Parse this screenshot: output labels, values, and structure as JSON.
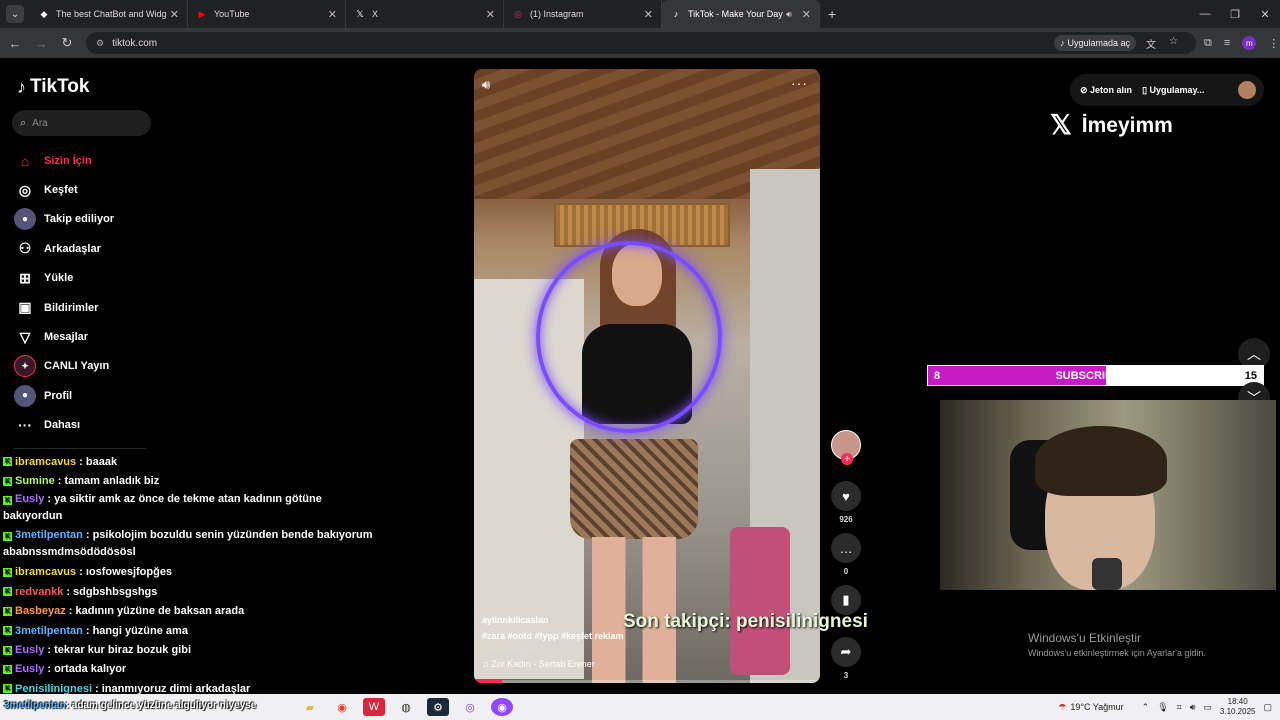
{
  "browser": {
    "tabs": [
      {
        "title": "The best ChatBot and Widgets",
        "icon": "streamelements-icon",
        "color": "#ffffff"
      },
      {
        "title": "YouTube",
        "icon": "youtube-icon",
        "color": "#ff0000"
      },
      {
        "title": "X",
        "icon": "x-icon",
        "color": "#ffffff"
      },
      {
        "title": "(1) Instagram",
        "icon": "instagram-icon",
        "color": "#e1306c"
      },
      {
        "title": "TikTok - Make Your Day",
        "icon": "tiktok-icon",
        "color": "#ffffff",
        "active": true
      }
    ],
    "url": "tiktok.com",
    "open_in_app": "Uygulamada aç",
    "profile_initial": "m"
  },
  "tiktok": {
    "logo": "TikTok",
    "search_placeholder": "Ara",
    "nav": [
      {
        "label": "Sizin İçin",
        "icon": "home-icon"
      },
      {
        "label": "Keşfet",
        "icon": "compass-icon"
      },
      {
        "label": "Takip ediliyor",
        "icon": "following-avatar-icon"
      },
      {
        "label": "Arkadaşlar",
        "icon": "friends-icon"
      },
      {
        "label": "Yükle",
        "icon": "upload-icon"
      },
      {
        "label": "Bildirimler",
        "icon": "notifications-icon"
      },
      {
        "label": "Mesajlar",
        "icon": "messages-icon"
      },
      {
        "label": "CANLI Yayın",
        "icon": "live-icon"
      },
      {
        "label": "Profil",
        "icon": "profile-icon"
      },
      {
        "label": "Dahası",
        "icon": "more-icon"
      }
    ],
    "top_right": {
      "coins": "Jeton alın",
      "get_app": "Uygulamay..."
    },
    "video": {
      "author": "aylinnkilicaslan",
      "tags": "#zara #ootd #fypp #keşfet reklam",
      "translate": "Çevirisini gör",
      "music": "Zor Kadın - Sertab Erener",
      "progress_pct": 8
    },
    "actions": {
      "likes": "926",
      "comments": "0",
      "shares": "3"
    }
  },
  "overlay": {
    "x_handle": "İmeyimm",
    "last_follower": "Son takipçi: penisilinignesi",
    "subscribers": {
      "current": "8",
      "label": "SUBSCRIBERS",
      "goal": "15",
      "fill_fraction": 0.53,
      "color": "#c51cc5"
    },
    "windows_activate_title": "Windows'u Etkinleştir",
    "windows_activate_sub": "Windows'u etkinleştirmek için Ayarlar'a gidin."
  },
  "chat": [
    {
      "name": "ibramcavus",
      "message": ": baaak",
      "color": "#f5d742"
    },
    {
      "name": "Sumine",
      "message": ": tamam anladık biz",
      "color": "#b9f66a"
    },
    {
      "name": "Eusly",
      "message": ": ya siktir amk az önce de tekme atan kadının götüne bakıyordun",
      "color": "#a970ff"
    },
    {
      "name": "3metilpentan",
      "message": ": psikolojim bozuldu senin yüzünden bende bakıyorum ababnssmdmsödödösösl",
      "color": "#5ab4ff"
    },
    {
      "name": "ibramcavus",
      "message": ": ıosfowesjfopğes",
      "color": "#f5d742"
    },
    {
      "name": "redvankk",
      "message": ": sdgbshbsgshgs",
      "color": "#ff5a5a"
    },
    {
      "name": "Basbeyaz",
      "message": ": kadının yüzüne de baksan arada",
      "color": "#ff9a3c"
    },
    {
      "name": "3metilpentan",
      "message": ": hangi yüzüne ama",
      "color": "#5ab4ff"
    },
    {
      "name": "Eusly",
      "message": ": tekrar kur biraz bozuk gibi",
      "color": "#a970ff"
    },
    {
      "name": "Eusly",
      "message": ": ortada kalıyor",
      "color": "#a970ff"
    },
    {
      "name": "Penisilinignesi",
      "message": ": inanmıyoruz dimi arkadaşlar",
      "color": "#4dd0e1"
    }
  ],
  "taskbar_chat": {
    "name": "3metilpentan",
    "message": ": adam gelince yüzüne alguliyor niyeyse"
  },
  "taskbar": {
    "weather": "19°C  Yağmur",
    "time": "18:40",
    "date": "3.10.2025"
  }
}
